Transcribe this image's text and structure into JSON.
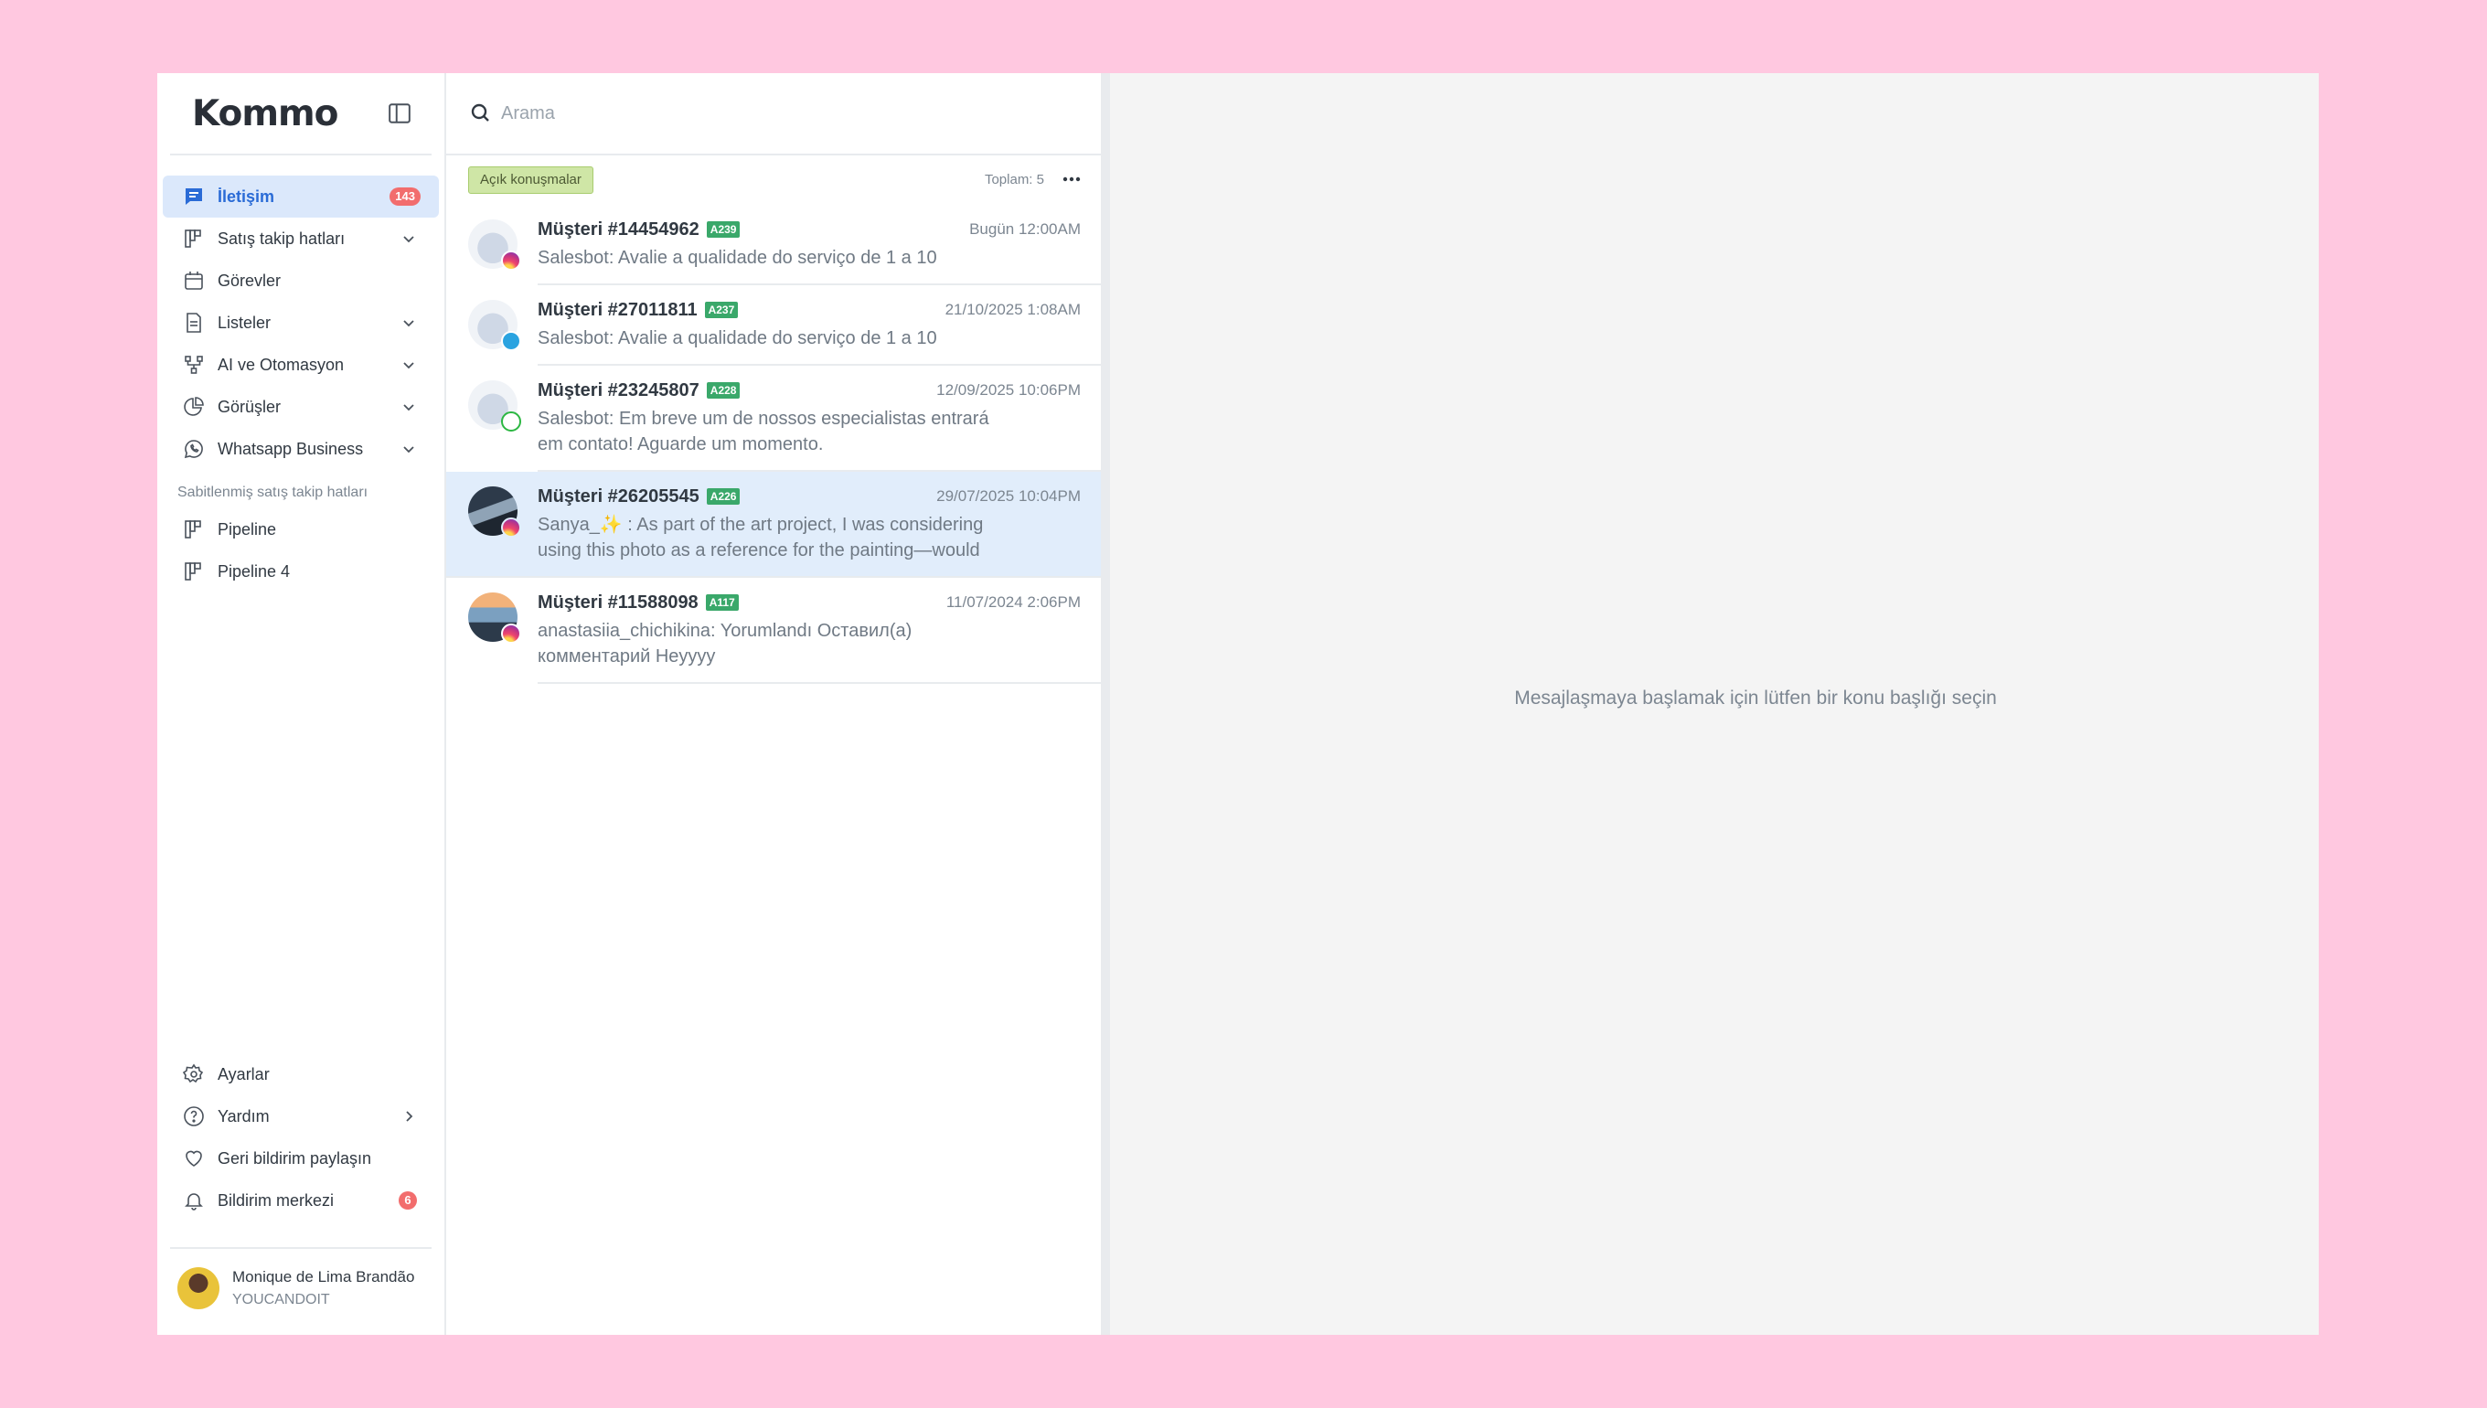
{
  "app": {
    "logo": "Kommo"
  },
  "sidebar": {
    "items": [
      {
        "label": "İletişim",
        "badge": "143",
        "icon": "chat-icon"
      },
      {
        "label": "Satış takip hatları",
        "icon": "pipeline-icon"
      },
      {
        "label": "Görevler",
        "icon": "calendar-icon"
      },
      {
        "label": "Listeler",
        "icon": "document-icon"
      },
      {
        "label": "AI ve Otomasyon",
        "icon": "automation-icon"
      },
      {
        "label": "Görüşler",
        "icon": "pie-chart-icon"
      },
      {
        "label": "Whatsapp Business",
        "icon": "whatsapp-icon"
      }
    ],
    "pinned_title": "Sabitlenmiş satış takip hatları",
    "pinned": [
      {
        "label": "Pipeline"
      },
      {
        "label": "Pipeline 4"
      }
    ],
    "bottom": [
      {
        "label": "Ayarlar",
        "icon": "gear-icon"
      },
      {
        "label": "Yardım",
        "icon": "help-icon"
      },
      {
        "label": "Geri bildirim paylaşın",
        "icon": "heart-icon"
      },
      {
        "label": "Bildirim merkezi",
        "badge": "6",
        "icon": "bell-icon"
      }
    ],
    "user": {
      "name": "Monique de Lima Brandão",
      "org": "YOUCANDOIT"
    }
  },
  "list": {
    "search_placeholder": "Arama",
    "filter": "Açık konuşmalar",
    "total": "Toplam: 5",
    "conversations": [
      {
        "name": "Müşteri #14454962",
        "tag": "A239",
        "time": "Bugün 12:00AM",
        "message": "Salesbot: Avalie a qualidade do serviço de 1 a 10",
        "channel": "instagram"
      },
      {
        "name": "Müşteri #27011811",
        "tag": "A237",
        "time": "21/10/2025 1:08AM",
        "message": "Salesbot: Avalie a qualidade do serviço de 1 a 10",
        "channel": "telegram"
      },
      {
        "name": "Müşteri #23245807",
        "tag": "A228",
        "time": "12/09/2025 10:06PM",
        "message": "Salesbot: Em breve um de nossos especialistas entrará em contato! Aguarde um momento.",
        "channel": "whatsapp"
      },
      {
        "name": "Müşteri #26205545",
        "tag": "A226",
        "time": "29/07/2025 10:04PM",
        "message": "Sanya_✨ : As part of the art project, I was considering using this photo as a reference for the painting—would",
        "channel": "instagram"
      },
      {
        "name": "Müşteri #11588098",
        "tag": "A117",
        "time": "11/07/2024 2:06PM",
        "message": "anastasiia_chichikina: Yorumlandı Оставил(а) комментарий Heyyyy",
        "channel": "instagram"
      }
    ]
  },
  "empty_state": "Mesajlaşmaya başlamak için lütfen bir konu başlığı seçin"
}
